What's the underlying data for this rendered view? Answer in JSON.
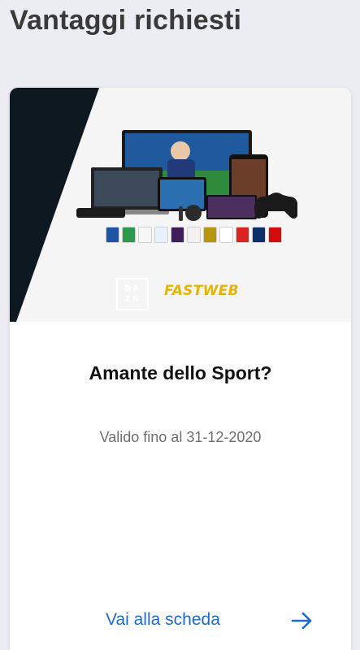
{
  "page": {
    "title": "Vantaggi richiesti"
  },
  "card": {
    "title": "Amante dello Sport?",
    "validity": "Valido fino al 31-12-2020",
    "cta_label": "Vai alla scheda",
    "cta_icon": "arrow-right-icon",
    "partner_logos": {
      "dazn": [
        "DA",
        "ZN"
      ],
      "fastweb": "FASTWEB"
    },
    "league_badges": [
      "serie-a",
      "serie-b",
      "liga",
      "ligue-1",
      "premier-league",
      "fa-cup",
      "copa-libertadores",
      "mls",
      "motogp",
      "nfl",
      "ufc"
    ]
  },
  "colors": {
    "background": "#ececf3",
    "accent": "#1c6ad8",
    "dark_panel": "#0d1820",
    "fastweb_yellow": "#e8b400"
  }
}
